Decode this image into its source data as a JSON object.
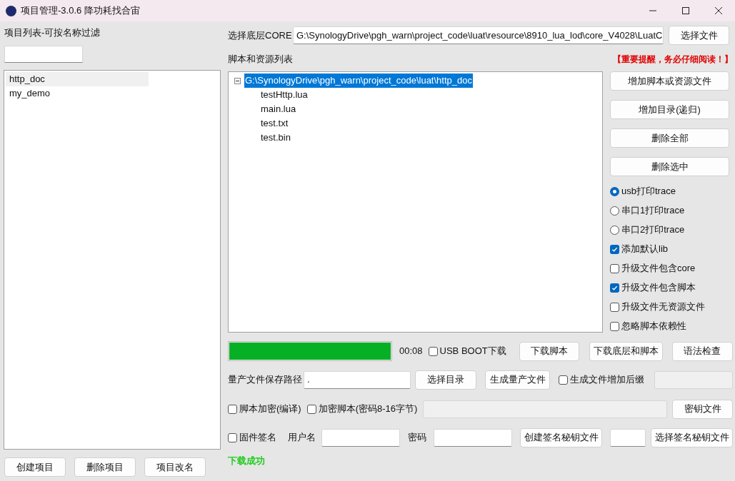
{
  "window": {
    "title": "项目管理-3.0.6 降功耗找合宙"
  },
  "project_list": {
    "label": "项目列表-可按名称过滤",
    "items": [
      {
        "label": "http_doc",
        "selected": true
      },
      {
        "label": "my_demo",
        "selected": false
      }
    ],
    "buttons": [
      "创建项目",
      "删除项目",
      "项目改名"
    ]
  },
  "core": {
    "label": "选择底层CORE",
    "path": "G:\\SynologyDrive\\pgh_warn\\project_code\\luat\\resource\\8910_lua_lod\\core_V4028\\LuatC",
    "button": "选择文件"
  },
  "scripts": {
    "label": "脚本和资源列表",
    "warning": "【重要提醒，务必仔细阅读！】",
    "tree": [
      {
        "label": "G:\\SynologyDrive\\pgh_warn\\project_code\\luat\\http_doc",
        "selected": true,
        "expanded": true,
        "children": [
          {
            "label": "testHttp.lua",
            "selected": false
          },
          {
            "label": "main.lua",
            "selected": false
          },
          {
            "label": "test.txt",
            "selected": false
          },
          {
            "label": "test.bin",
            "selected": false
          }
        ]
      }
    ],
    "buttons": [
      "增加脚本或资源文件",
      "增加目录(递归)",
      "删除全部",
      "删除选中"
    ],
    "options": [
      {
        "kind": "radio",
        "label": "usb打印trace",
        "checked": true
      },
      {
        "kind": "radio",
        "label": "串口1打印trace",
        "checked": false
      },
      {
        "kind": "radio",
        "label": "串口2打印trace",
        "checked": false
      },
      {
        "kind": "checkbox",
        "label": "添加默认lib",
        "checked": true
      },
      {
        "kind": "checkbox",
        "label": "升级文件包含core",
        "checked": false
      },
      {
        "kind": "checkbox",
        "label": "升级文件包含脚本",
        "checked": true
      },
      {
        "kind": "checkbox",
        "label": "升级文件无资源文件",
        "checked": false
      },
      {
        "kind": "checkbox",
        "label": "忽略脚本依赖性",
        "checked": false
      }
    ]
  },
  "download": {
    "progress": {
      "level": 1
    },
    "time": "00:08",
    "usb_boot": {
      "label": "USB BOOT下载",
      "checked": false
    },
    "buttons": [
      "下载脚本",
      "下载底层和脚本",
      "语法检查"
    ]
  },
  "production": {
    "label": "量产文件保存路径",
    "path": ".",
    "buttons": [
      "选择目录",
      "生成量产文件"
    ],
    "suffix": {
      "label": "生成文件增加后缀",
      "checked": false
    }
  },
  "encryption": {
    "compile": {
      "label": "脚本加密(编译)",
      "checked": false
    },
    "encrypt": {
      "label": "加密脚本(密码8-16字节)",
      "checked": false
    },
    "button": "密钥文件"
  },
  "signing": {
    "firmware": {
      "label": "固件签名",
      "checked": false
    },
    "username_label": "用户名",
    "password_label": "密码",
    "create_button": "创建签名秘钥文件",
    "select_button": "选择签名秘钥文件"
  },
  "status": "下载成功"
}
